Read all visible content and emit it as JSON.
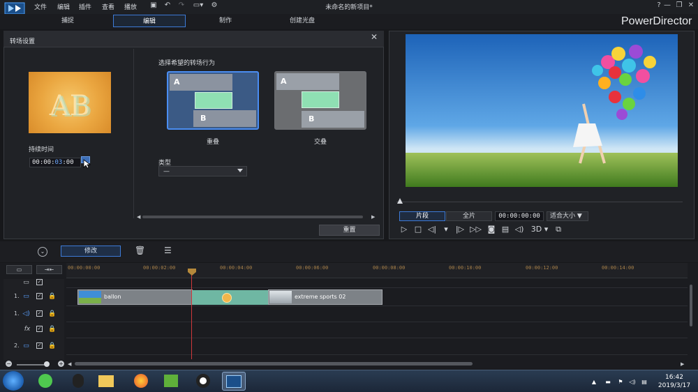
{
  "app": {
    "brand": "PowerDirector",
    "window_title": "未命名的新项目*",
    "menu": [
      "文件",
      "编辑",
      "插件",
      "查看",
      "播放"
    ],
    "tabs": [
      "捕捉",
      "编辑",
      "制作",
      "创建光盘"
    ],
    "active_tab": "编辑"
  },
  "transition_panel": {
    "title": "转场设置",
    "preview_text": "AB",
    "duration_label": "持续时间",
    "duration_prefix": "00:00:",
    "duration_selected": "03",
    "duration_suffix": ":00",
    "behavior_label": "选择希望的转场行为",
    "behaviors": [
      {
        "name": "重叠",
        "a": "A",
        "b": "B",
        "selected": true
      },
      {
        "name": "交叠",
        "a": "A",
        "b": "B",
        "selected": false
      }
    ],
    "type_label": "类型",
    "type_value": "—",
    "reset_label": "重置"
  },
  "preview": {
    "mode_tabs": [
      "片段",
      "全片"
    ],
    "active_mode": "片段",
    "timecode": "00:00:00:00",
    "fit_label": "适合大小 ▼",
    "playback_buttons": [
      "play-icon",
      "stop-icon",
      "prev-frame-icon",
      "marker-icon",
      "next-frame-icon",
      "fast-forward-icon",
      "snapshot-icon",
      "subtitles-icon",
      "volume-icon"
    ],
    "three_d_label": "3D ▾"
  },
  "toolbar": {
    "modify_label": "修改"
  },
  "timeline": {
    "ruler": [
      "00:00:00:00",
      "00:00:02:00",
      "00:00:04:00",
      "00:00:06:00",
      "00:00:08:00",
      "00:00:10:00",
      "00:00:12:00",
      "00:00:14:00"
    ],
    "tracks": [
      {
        "num": "1.",
        "kind": "video"
      },
      {
        "num": "1.",
        "kind": "audio"
      },
      {
        "num": "",
        "kind": "fx",
        "label": "fx"
      },
      {
        "num": "2.",
        "kind": "video"
      }
    ],
    "clips": [
      {
        "label": "ballon"
      },
      {
        "label": "extreme sports 02"
      }
    ]
  },
  "taskbar": {
    "time": "16:42",
    "date": "2019/3/17"
  },
  "colors": {
    "accent": "#3d7bd8",
    "transition_green": "#8fe0b3",
    "playhead": "#d0383b"
  }
}
